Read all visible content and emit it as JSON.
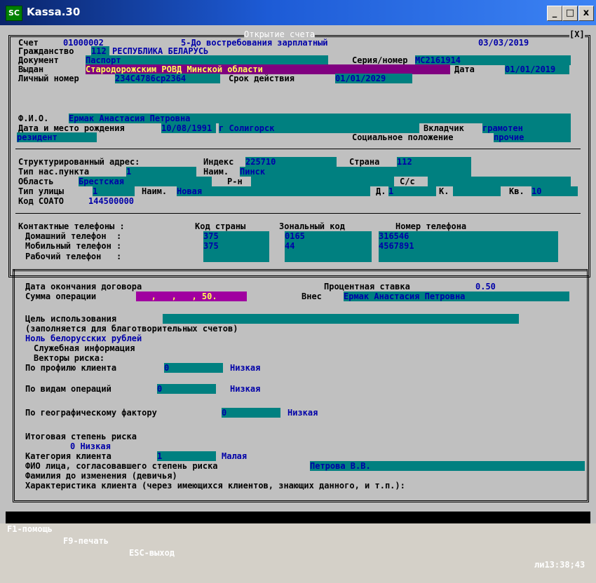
{
  "window": {
    "title": "Kassa.30",
    "icon_text": "SC",
    "min": "_",
    "max": "□",
    "close": "x"
  },
  "dialog": {
    "title": "Открытие счета",
    "close_mark": "[X]"
  },
  "account": {
    "label": "Счет",
    "number": "01000002",
    "type": "5-До востребования зарплатный",
    "date": "03/03/2019"
  },
  "citizenship": {
    "label": "Гражданство",
    "code": "112",
    "name": "РЕСПУБЛИКА БЕЛАРУСЬ"
  },
  "document": {
    "label": "Документ",
    "value": "Паспорт",
    "series_label": "Серия/номер",
    "series": "MC2161914"
  },
  "issued": {
    "label": "Выдан",
    "value": "Стародорожским РОВД Минской области",
    "date_label": "Дата",
    "date": "01/01/2019"
  },
  "personal": {
    "label": "Личный номер",
    "value": "234C4786cp2364",
    "valid_label": "Срок действия",
    "valid": "01/01/2029"
  },
  "fio": {
    "label": "Ф.И.О.",
    "value": "Ермак Анастасия Петровна"
  },
  "birth": {
    "label": "Дата и место рождения",
    "date": "10/08/1991",
    "place": "г Солигорск",
    "depositor_label": "Вкладчик",
    "depositor": "грамотен"
  },
  "resident": {
    "value": "резидент",
    "social_label": "Социальное положение",
    "social": "прочие"
  },
  "address": {
    "label": "Структурированный адрес:",
    "index_label": "Индекс",
    "index": "225710",
    "country_label": "Страна",
    "country": "112",
    "settle_type_label": "Тип нас.пункта",
    "settle_type": "1",
    "settle_name_label": "Наим.",
    "settle_name": "Пинск",
    "region_label": "Область",
    "region": "Брестская",
    "district_label": "Р-н",
    "ss_label": "С/с",
    "street_type_label": "Тип улицы",
    "street_type": "1",
    "street_name_label": "Наим.",
    "street_name": "Новая",
    "house_label": "Д.",
    "house": "1",
    "building_label": "К.",
    "apt_label": "Кв.",
    "apt": "10",
    "soato_label": "Код СОАТО",
    "soato": "144500000"
  },
  "phones": {
    "label": "Контактные телефоны :",
    "col_country": "Код страны",
    "col_zone": "Зональный код",
    "col_number": "Номер телефона",
    "rows": [
      {
        "label": "Домашний телефон  :",
        "country": "375",
        "zone": "0165",
        "number": "316546"
      },
      {
        "label": "Мобильный телефон :",
        "country": "375",
        "zone": "44",
        "number": "4567891"
      },
      {
        "label": "Рабочий телефон   :",
        "country": "",
        "zone": "",
        "number": ""
      }
    ]
  },
  "contract": {
    "end_label": "Дата окончания договора",
    "rate_label": "Процентная ставка",
    "rate": "0.50",
    "sum_label": "Сумма операции",
    "sum": "   ,   ,   , 50.",
    "depositor_label": "Внес",
    "depositor": "Ермак Анастасия Петровна"
  },
  "purpose": {
    "label": "Цель использования",
    "note": "(заполняется для благотворительных счетов)",
    "amount_words": "Ноль белорусских рублей"
  },
  "service": {
    "label": "Служебная информация",
    "vectors": "Векторы риска:",
    "profile_label": "По профилю клиента",
    "profile": "0",
    "profile_level": "Низкая",
    "ops_label": "По видам операций",
    "ops": "0",
    "ops_level": "Низкая",
    "geo_label": "По географическому фактору",
    "geo": "0",
    "geo_level": "Низкая",
    "total_label": "Итоговая степень риска",
    "total": "0 Низкая",
    "category_label": "Категория клиента",
    "category": "1",
    "category_level": "Малая",
    "approver_label": "ФИО лица, согласовавшего степень риска",
    "approver": "Петрова В.В.",
    "maiden_label": "Фамилия до изменения (девичья)",
    "char_label": "Характеристика клиента (через имеющихся клиентов, знающих данного, и т.п.):"
  },
  "status": {
    "help": "F1-помощь",
    "print": "F9-печать",
    "exit": "ESC-выход",
    "clock": "ли13:38;43"
  }
}
